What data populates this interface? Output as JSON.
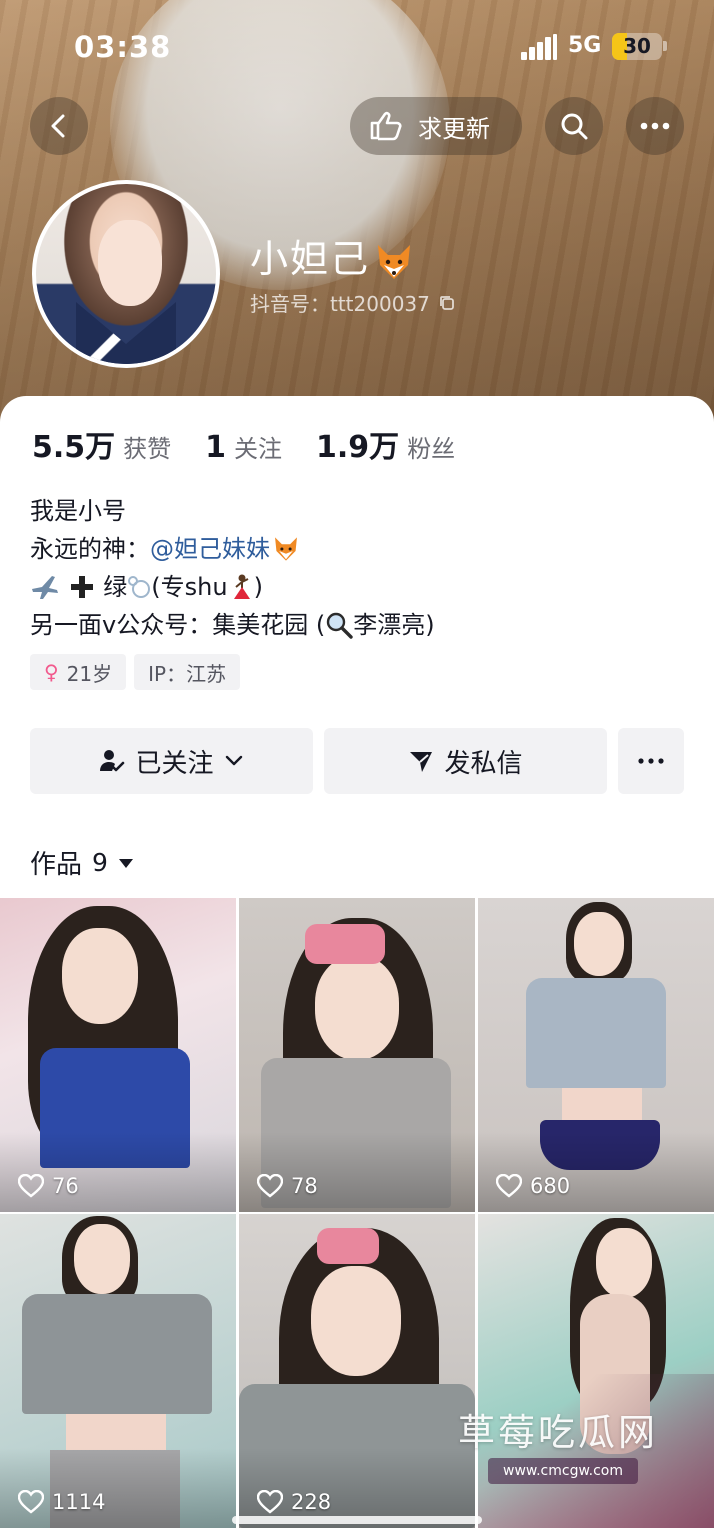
{
  "status_bar": {
    "time": "03:38",
    "network": "5G",
    "battery": "30",
    "battery_level": 0.3
  },
  "header": {
    "update_label": "求更新"
  },
  "profile": {
    "nickname": "小妲己",
    "douyin_id": "抖音号：ttt200037"
  },
  "stats": [
    {
      "value": "5.5万",
      "label": "获赞"
    },
    {
      "value": "1",
      "label": "关注"
    },
    {
      "value": "1.9万",
      "label": "粉丝"
    }
  ],
  "bio": {
    "line1": "我是小号",
    "line2_prefix": "永远的神：",
    "line2_mention": "@妲己妹妹",
    "line3_text": "绿",
    "line3_suffix": "(专shu",
    "line3_end": ")",
    "line4": "另一面v公众号：集美花园 (",
    "line4_search": "李漂亮)"
  },
  "tags": {
    "age": "21岁",
    "ip": "IP：江苏"
  },
  "actions": {
    "follow_label": "已关注",
    "message_label": "发私信"
  },
  "works": {
    "label": "作品",
    "count": "9"
  },
  "videos": [
    {
      "likes": "76"
    },
    {
      "likes": "78"
    },
    {
      "likes": "680"
    },
    {
      "likes": "1114"
    },
    {
      "likes": "228"
    },
    {
      "likes": ""
    }
  ],
  "watermark": {
    "text": "草莓吃瓜网",
    "url": "www.cmcgw.com"
  },
  "colors": {
    "mention": "#2f5d9c",
    "female": "#f25a8d",
    "battery": "#f5c518",
    "button_bg": "#f2f2f4"
  }
}
